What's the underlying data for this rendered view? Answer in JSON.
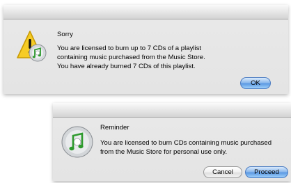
{
  "colors": {
    "default_button": "#7fb3ee",
    "dialog_bg": "#e7e7e7"
  },
  "dialogs": [
    {
      "icon": "warning-itunes-icon",
      "title": "Sorry",
      "lines": [
        "You are licensed to burn up to 7 CDs of a playlist",
        "containing music purchased from the Music Store.",
        "You have already burned 7 CDs of this playlist."
      ],
      "buttons": [
        "OK"
      ]
    },
    {
      "icon": "itunes-cd-icon",
      "title": "Reminder",
      "lines": [
        "You are licensed to burn CDs containing music purchased",
        "from the Music Store for personal use only."
      ],
      "buttons": [
        "Cancel",
        "Proceed"
      ]
    }
  ]
}
